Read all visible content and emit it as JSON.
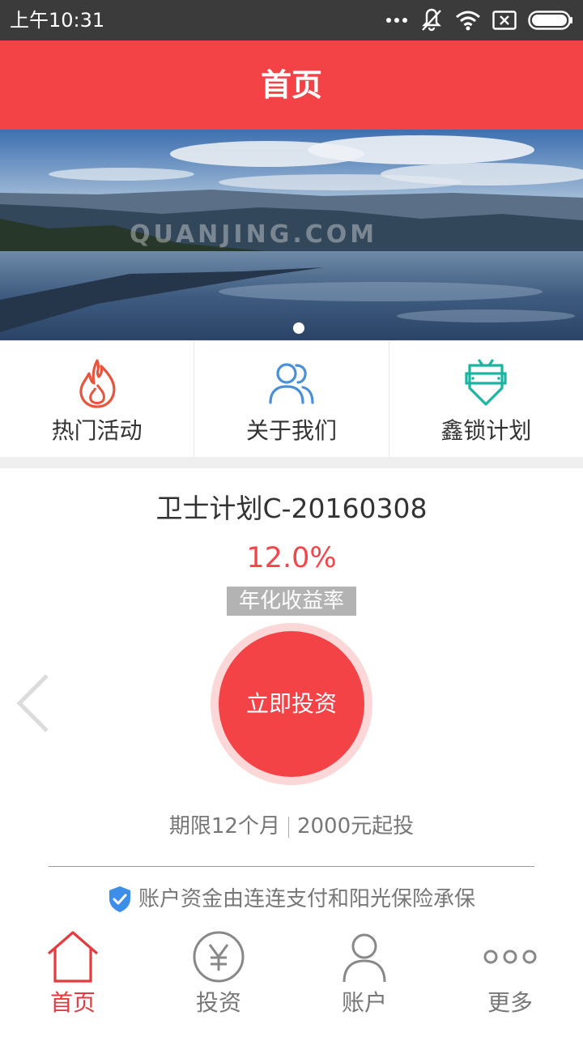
{
  "status_bar": {
    "time": "上午10:31",
    "icons": [
      "more-dots-icon",
      "vibrate-off-icon",
      "wifi-icon",
      "no-sim-icon",
      "battery-icon"
    ]
  },
  "header": {
    "title": "首页"
  },
  "banner": {
    "watermark": "QUANJING.COM",
    "slide_count": 1,
    "active_slide": 1
  },
  "quick_menu": [
    {
      "label": "热门活动",
      "icon": "flame-icon",
      "color": "#e8543c"
    },
    {
      "label": "关于我们",
      "icon": "users-icon",
      "color": "#4a90d9"
    },
    {
      "label": "鑫锁计划",
      "icon": "safe-box-icon",
      "color": "#19b5a0"
    }
  ],
  "product": {
    "name": "卫士计划C-20160308",
    "rate": "12.0%",
    "rate_label": "年化收益率",
    "invest_button": "立即投资",
    "term": "期限12个月",
    "min_invest": "2000元起投",
    "guarantee": "账户资金由连连支付和阳光保险承保"
  },
  "bottom_nav": [
    {
      "label": "首页",
      "icon": "home-icon",
      "active": true
    },
    {
      "label": "投资",
      "icon": "yen-coin-icon",
      "active": false
    },
    {
      "label": "账户",
      "icon": "user-icon",
      "active": false
    },
    {
      "label": "更多",
      "icon": "more-icon",
      "active": false
    }
  ],
  "colors": {
    "brand": "#f44347",
    "invest_ring": "#fcd7d7",
    "rate_tag_bg": "#b3b3b3",
    "active_nav": "#e53a3e",
    "guarantee_shield": "#3d8ee8"
  }
}
